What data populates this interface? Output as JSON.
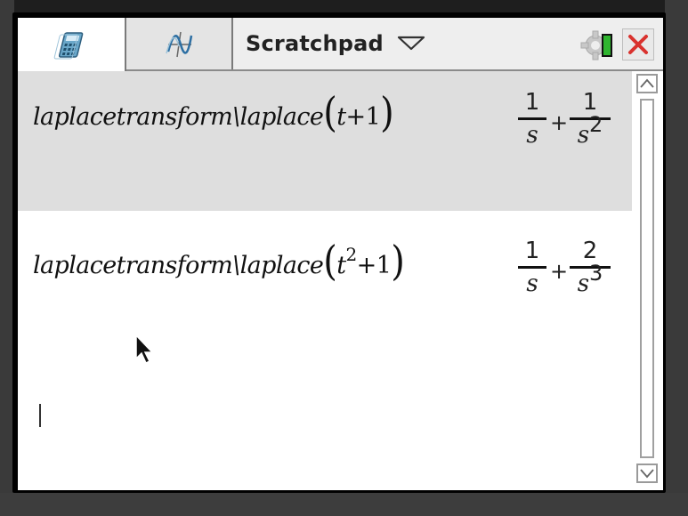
{
  "window": {
    "title": "Scratchpad",
    "tabs": [
      {
        "name": "calculator",
        "icon": "calculator-icon",
        "selected": true
      },
      {
        "name": "graphs",
        "icon": "graph-icon",
        "selected": false
      }
    ],
    "status": {
      "battery_icon": "battery-icon",
      "settings_icon": "gear-icon"
    },
    "close_icon": "close-icon"
  },
  "history": [
    {
      "input": {
        "func": "laplacetransform\\laplace",
        "arg_base": "t",
        "arg_exp": "",
        "arg_rest": "+1"
      },
      "result": {
        "frac1": {
          "num": "1",
          "den": "s",
          "den_exp": ""
        },
        "op": "+",
        "frac2": {
          "num": "1",
          "den": "s",
          "den_exp": "2"
        }
      },
      "highlighted": true
    },
    {
      "input": {
        "func": "laplacetransform\\laplace",
        "arg_base": "t",
        "arg_exp": "2",
        "arg_rest": "+1"
      },
      "result": {
        "frac1": {
          "num": "1",
          "den": "s",
          "den_exp": ""
        },
        "op": "+",
        "frac2": {
          "num": "2",
          "den": "s",
          "den_exp": "3"
        }
      },
      "highlighted": false
    }
  ],
  "entry_line": {
    "value": ""
  },
  "colors": {
    "highlight": "#dedede",
    "close_red": "#d9322e",
    "battery_green": "#2fb52f"
  }
}
